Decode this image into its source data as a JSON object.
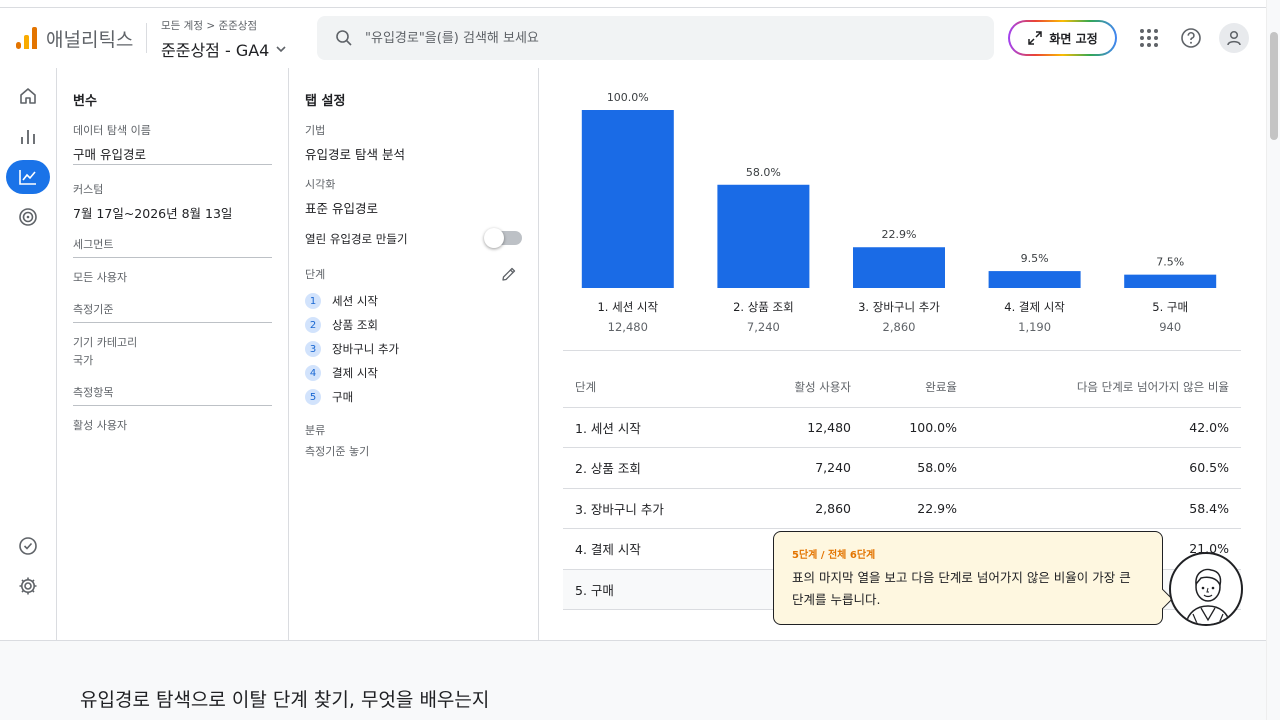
{
  "header": {
    "app_name": "애널리틱스",
    "breadcrumb": "모든 계정 > 준준상점",
    "property": "준준상점 - GA4",
    "search_placeholder": "\"유입경로\"을(를) 검색해 보세요",
    "pin_label": "화면 고정"
  },
  "variables": {
    "title": "변수",
    "exploration_name_label": "데이터 탐색 이름",
    "exploration_name": "구매 유입경로",
    "custom_label": "커스텀",
    "date_range": "7월 17일~2026년 8월 13일",
    "segments_label": "세그먼트",
    "segment_value": "모든 사용자",
    "dimensions_label": "측정기준",
    "dimension_value": "기기 카테고리",
    "dimension_value2": "국가",
    "metrics_label": "측정항목",
    "metric_value": "활성 사용자"
  },
  "tab_settings": {
    "title": "탭 설정",
    "technique_label": "기법",
    "technique": "유입경로 탐색 분석",
    "visualization_label": "시각화",
    "visualization": "표준 유입경로",
    "open_funnel_label": "열린 유입경로 만들기",
    "steps_label": "단계",
    "steps": [
      {
        "num": "1",
        "label": "세션 시작"
      },
      {
        "num": "2",
        "label": "상품 조회"
      },
      {
        "num": "3",
        "label": "장바구니 추가"
      },
      {
        "num": "4",
        "label": "결제 시작"
      },
      {
        "num": "5",
        "label": "구매"
      }
    ],
    "breakdown_label": "분류",
    "breakdown_value": "측정기준 놓기"
  },
  "chart_data": {
    "type": "bar",
    "categories": [
      "1. 세션 시작",
      "2. 상품 조회",
      "3. 장바구니 추가",
      "4. 결제 시작",
      "5. 구매"
    ],
    "values": [
      100.0,
      58.0,
      22.9,
      9.5,
      7.5
    ],
    "value_labels": [
      "100.0%",
      "58.0%",
      "22.9%",
      "9.5%",
      "7.5%"
    ],
    "counts": [
      "12,480",
      "7,240",
      "2,860",
      "1,190",
      "940"
    ],
    "ylim": [
      0,
      100
    ],
    "color": "#1a6be6"
  },
  "table": {
    "headers": [
      "단계",
      "활성 사용자",
      "완료율",
      "다음 단계로 넘어가지 않은 비율"
    ],
    "rows": [
      [
        "1. 세션 시작",
        "12,480",
        "100.0%",
        "42.0%"
      ],
      [
        "2. 상품 조회",
        "7,240",
        "58.0%",
        "60.5%"
      ],
      [
        "3. 장바구니 추가",
        "2,860",
        "22.9%",
        "58.4%"
      ],
      [
        "4. 결제 시작",
        "",
        "",
        "21.0%"
      ],
      [
        "5. 구매",
        "",
        "",
        ""
      ]
    ]
  },
  "tooltip": {
    "step": "5단계 / 전체 6단계",
    "message": "표의 마지막 열을 보고 다음 단계로 넘어가지 않은 비율이 가장 큰 단계를 누릅니다."
  },
  "bottom": {
    "heading": "유입경로 탐색으로 이탈 단계 찾기, 무엇을 배우는지"
  },
  "icons": {
    "nav": [
      "home-icon",
      "reports-icon",
      "explore-icon",
      "advertising-icon",
      "insights-icon",
      "settings-icon"
    ],
    "header": [
      "search-icon",
      "expand-icon",
      "apps-icon",
      "help-icon",
      "account-icon"
    ]
  }
}
